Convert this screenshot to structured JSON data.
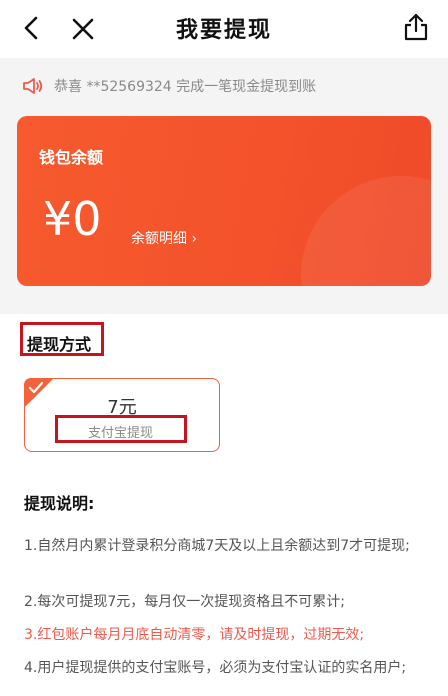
{
  "header": {
    "title": "我要提现",
    "icons": [
      "chevron-left-icon",
      "close-icon",
      "share-icon"
    ]
  },
  "notice": {
    "icon": "speaker-icon",
    "text": "恭喜 **52569324 完成一笔现金提现到账"
  },
  "wallet": {
    "label": "钱包余额",
    "amount": "¥0",
    "detail_link": "余额明细 ›",
    "color": "#f3522b"
  },
  "withdraw": {
    "section_title": "提现方式",
    "option": {
      "price": "7元",
      "method": "支付宝提现",
      "selected": true
    }
  },
  "rules": {
    "title": "提现说明:",
    "items": [
      "1.自然月内累计登录积分商城7天及以上且余额达到7才可提现;",
      "2.每次可提现7元，每月仅一次提现资格且不可累计;",
      "3.红包账户每月月底自动清零，请及时提现，过期无效;",
      "4.用户提现提供的支付宝账号，必须为支付宝认证的实名用户;"
    ],
    "highlight_color": "#ef5a4d"
  }
}
